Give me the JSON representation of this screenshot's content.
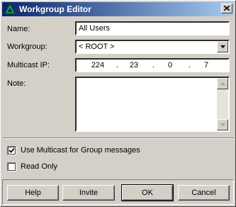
{
  "window": {
    "title": "Workgroup Editor",
    "icon": "green-triangle-icon",
    "close_icon": "close-icon"
  },
  "form": {
    "name_label": "Name:",
    "name_value": "All Users",
    "workgroup_label": "Workgroup:",
    "workgroup_value": "< ROOT >",
    "multicast_label": "Multicast IP:",
    "multicast_ip": [
      "224",
      "23",
      "0",
      "7"
    ],
    "ip_separator": ".",
    "note_label": "Note:",
    "note_value": ""
  },
  "options": {
    "use_multicast_label": "Use Multicast for Group messages",
    "use_multicast_checked": true,
    "read_only_label": "Read Only",
    "read_only_checked": false
  },
  "buttons": {
    "help": "Help",
    "invite": "Invite",
    "ok": "OK",
    "cancel": "Cancel"
  },
  "colors": {
    "title_start": "#0a246a",
    "title_end": "#a6caf0",
    "face": "#d4d0c8",
    "icon_green": "#1aa34a"
  }
}
